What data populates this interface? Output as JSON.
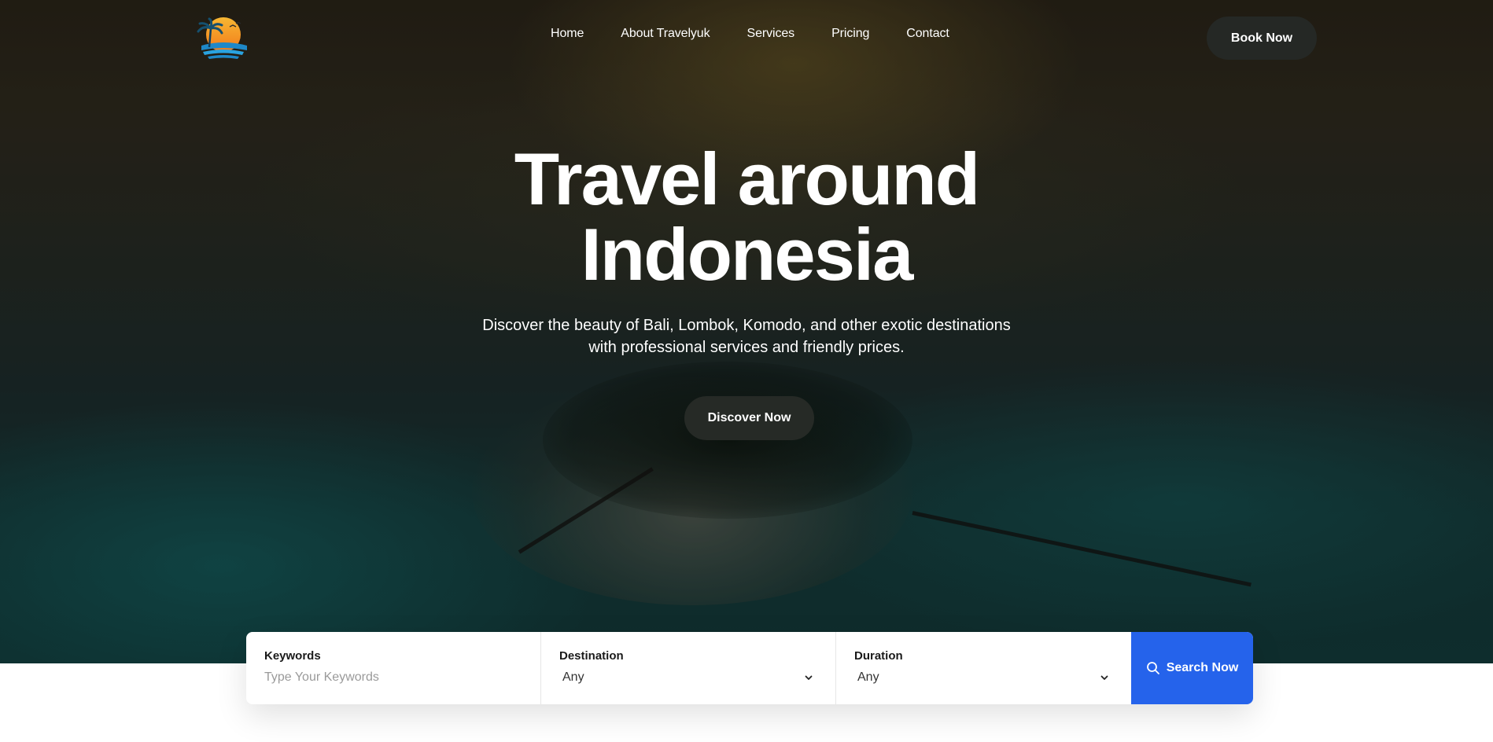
{
  "nav": {
    "items": [
      {
        "label": "Home"
      },
      {
        "label": "About Travelyuk"
      },
      {
        "label": "Services"
      },
      {
        "label": "Pricing"
      },
      {
        "label": "Contact"
      }
    ],
    "cta_label": "Book Now"
  },
  "hero": {
    "title_line1": "Travel around",
    "title_line2": "Indonesia",
    "subtitle_line1": "Discover the beauty of Bali, Lombok, Komodo, and other exotic destinations",
    "subtitle_line2": "with professional services and friendly prices.",
    "cta_label": "Discover Now"
  },
  "search": {
    "keywords_label": "Keywords",
    "keywords_placeholder": "Type Your Keywords",
    "destination_label": "Destination",
    "destination_value": "Any",
    "duration_label": "Duration",
    "duration_value": "Any",
    "button_label": "Search Now"
  },
  "colors": {
    "accent": "#2563eb",
    "dark_button": "#252825"
  }
}
